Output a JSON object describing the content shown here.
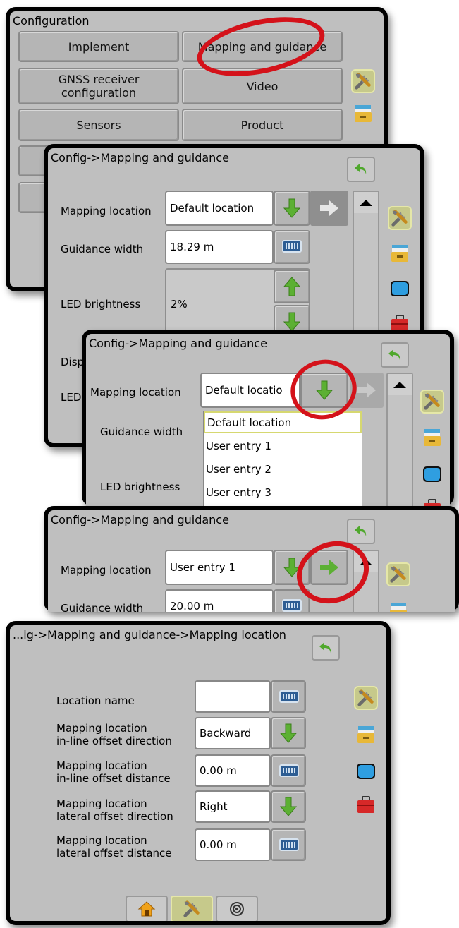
{
  "screen1": {
    "title": "Configuration",
    "buttons": [
      "Implement",
      "Mapping and guidance",
      "GNSS receiver configuration",
      "Video",
      "Sensors",
      "Product"
    ]
  },
  "screen2": {
    "title": "Config->Mapping and guidance",
    "mapping_label": "Mapping location",
    "mapping_value": "Default location",
    "guidance_label": "Guidance width",
    "guidance_value": "18.29 m",
    "led_label": "LED brightness",
    "led_value": "2%",
    "disp_label": "Disp",
    "led2_label": "LED"
  },
  "screen3": {
    "title": "Config->Mapping and guidance",
    "mapping_label": "Mapping location",
    "mapping_value": "Default locatio",
    "guidance_label": "Guidance width",
    "led_label": "LED brightness",
    "options": [
      "Default location",
      "User entry 1",
      "User entry 2",
      "User entry 3"
    ]
  },
  "screen4": {
    "title": "Config->Mapping and guidance",
    "mapping_label": "Mapping location",
    "mapping_value": "User entry 1",
    "guidance_label": "Guidance width",
    "guidance_value": "20.00 m"
  },
  "screen5": {
    "title": "...ig->Mapping and guidance->Mapping location",
    "rows": [
      {
        "label": "Location name",
        "value": ""
      },
      {
        "label": "Mapping location\nin-line offset direction",
        "value": "Backward"
      },
      {
        "label": "Mapping location\nin-line offset distance",
        "value": "0.00 m"
      },
      {
        "label": "Mapping location\nlateral offset direction",
        "value": "Right"
      },
      {
        "label": "Mapping location\nlateral offset distance",
        "value": "0.00 m"
      }
    ]
  },
  "colors": {
    "highlight": "#d4121a",
    "arrow_green": "#5cb033",
    "selected_tab": "#c6c98b"
  },
  "icons": [
    "tools-icon",
    "files-icon",
    "display-icon",
    "toolbox-icon",
    "home-icon",
    "gps-icon",
    "back-icon",
    "keyboard-icon"
  ]
}
